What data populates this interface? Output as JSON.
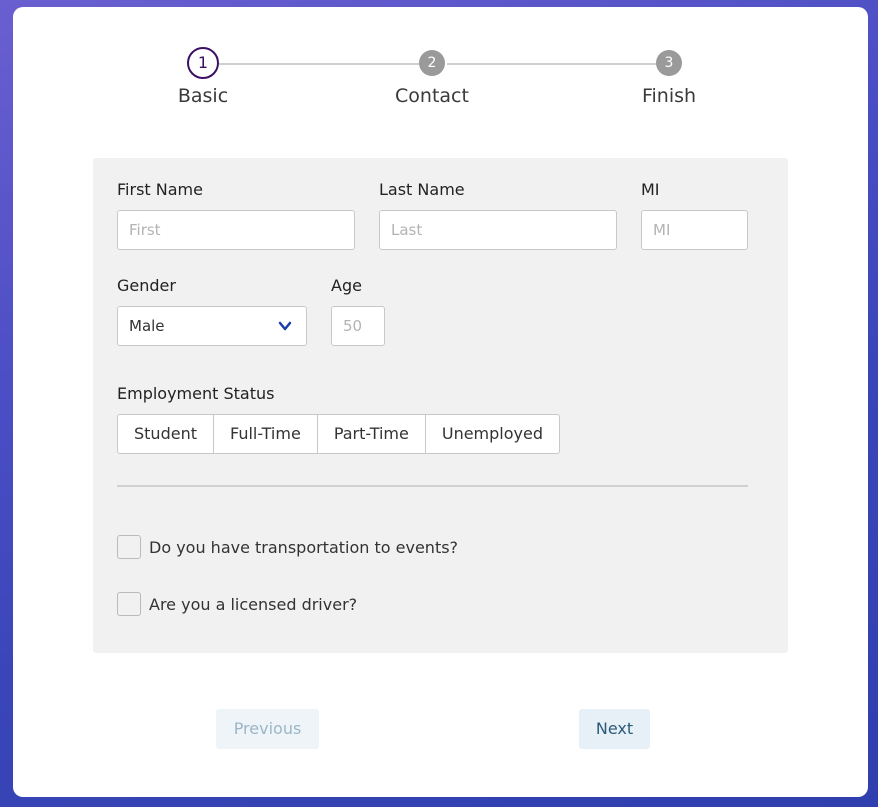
{
  "stepper": {
    "steps": [
      {
        "number": "1",
        "label": "Basic",
        "active": true
      },
      {
        "number": "2",
        "label": "Contact",
        "active": false
      },
      {
        "number": "3",
        "label": "Finish",
        "active": false
      }
    ]
  },
  "form": {
    "first_name": {
      "label": "First Name",
      "placeholder": "First",
      "value": ""
    },
    "last_name": {
      "label": "Last Name",
      "placeholder": "Last",
      "value": ""
    },
    "mi": {
      "label": "MI",
      "placeholder": "MI",
      "value": ""
    },
    "gender": {
      "label": "Gender",
      "selected": "Male"
    },
    "age": {
      "label": "Age",
      "placeholder": "50",
      "value": ""
    },
    "employment": {
      "label": "Employment Status",
      "options": [
        "Student",
        "Full-Time",
        "Part-Time",
        "Unemployed"
      ]
    },
    "transportation": {
      "label": "Do you have transportation to events?",
      "checked": false
    },
    "licensed": {
      "label": "Are you a licensed driver?",
      "checked": false
    }
  },
  "nav": {
    "previous_label": "Previous",
    "next_label": "Next"
  },
  "colors": {
    "active_step": "#3b1063",
    "inactive_step": "#9a9a9a",
    "chevron": "#1b3fa8"
  }
}
